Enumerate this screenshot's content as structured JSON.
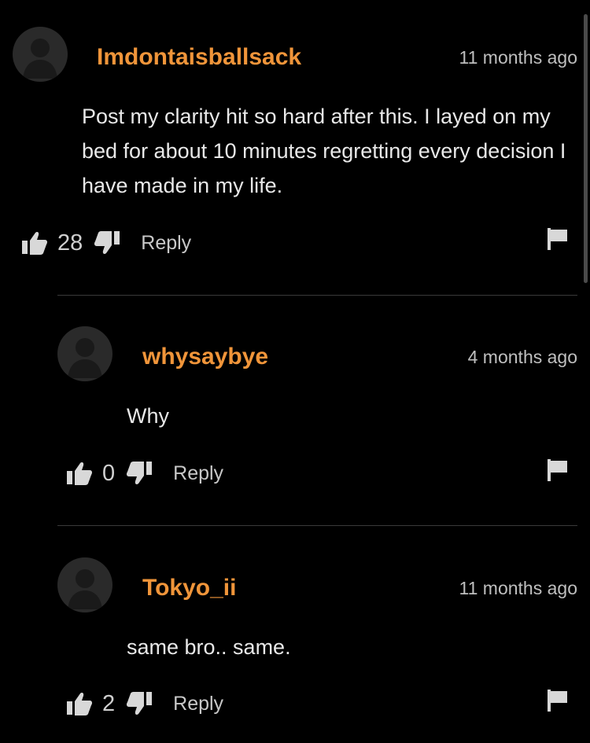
{
  "comments": [
    {
      "username": "Imdontaisballsack",
      "timestamp": "11 months ago",
      "text": "Post my clarity hit so hard after this. I layed on my bed for about 10 minutes regretting every decision I have made in my life.",
      "likes": "28",
      "reply_label": "Reply"
    },
    {
      "username": "whysaybye",
      "timestamp": "4 months ago",
      "text": "Why",
      "likes": "0",
      "reply_label": "Reply"
    },
    {
      "username": "Tokyo_ii",
      "timestamp": "11 months ago",
      "text": "same bro.. same.",
      "likes": "2",
      "reply_label": "Reply"
    }
  ],
  "colors": {
    "background": "#000000",
    "username": "#f0953a",
    "text": "#e8e8e8",
    "muted": "#bfbfbf",
    "divider": "#3a3a3a"
  },
  "icons": {
    "like": "thumbs-up-icon",
    "dislike": "thumbs-down-icon",
    "report": "flag-icon",
    "avatar": "default-avatar-icon"
  }
}
